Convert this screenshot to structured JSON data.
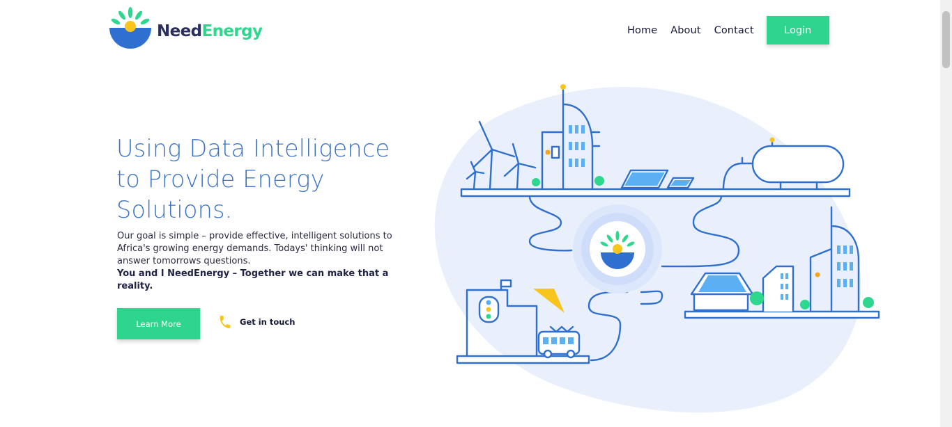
{
  "brand": {
    "name_part1": "Need",
    "name_part2": "Energy",
    "colors": {
      "navy": "#2b2f5e",
      "green": "#2fd68d",
      "blue": "#2f6fd0",
      "yellow": "#f7c51d"
    }
  },
  "nav": {
    "items": [
      {
        "label": "Home"
      },
      {
        "label": "About"
      },
      {
        "label": "Contact"
      }
    ],
    "login_label": "Login"
  },
  "hero": {
    "title_line1": "Using Data Intelligence",
    "title_line2": "to Provide Energy",
    "title_line3": "Solutions.",
    "description": "Our goal is simple – provide effective, intelligent solutions to Africa's growing energy demands. Todays' thinking will not answer tomorrows questions.",
    "tagline": "You and I NeedEnergy – Together we can make that a reality.",
    "primary_cta": "Learn More",
    "secondary_cta": "Get in touch",
    "secondary_icon": "phone-icon"
  }
}
